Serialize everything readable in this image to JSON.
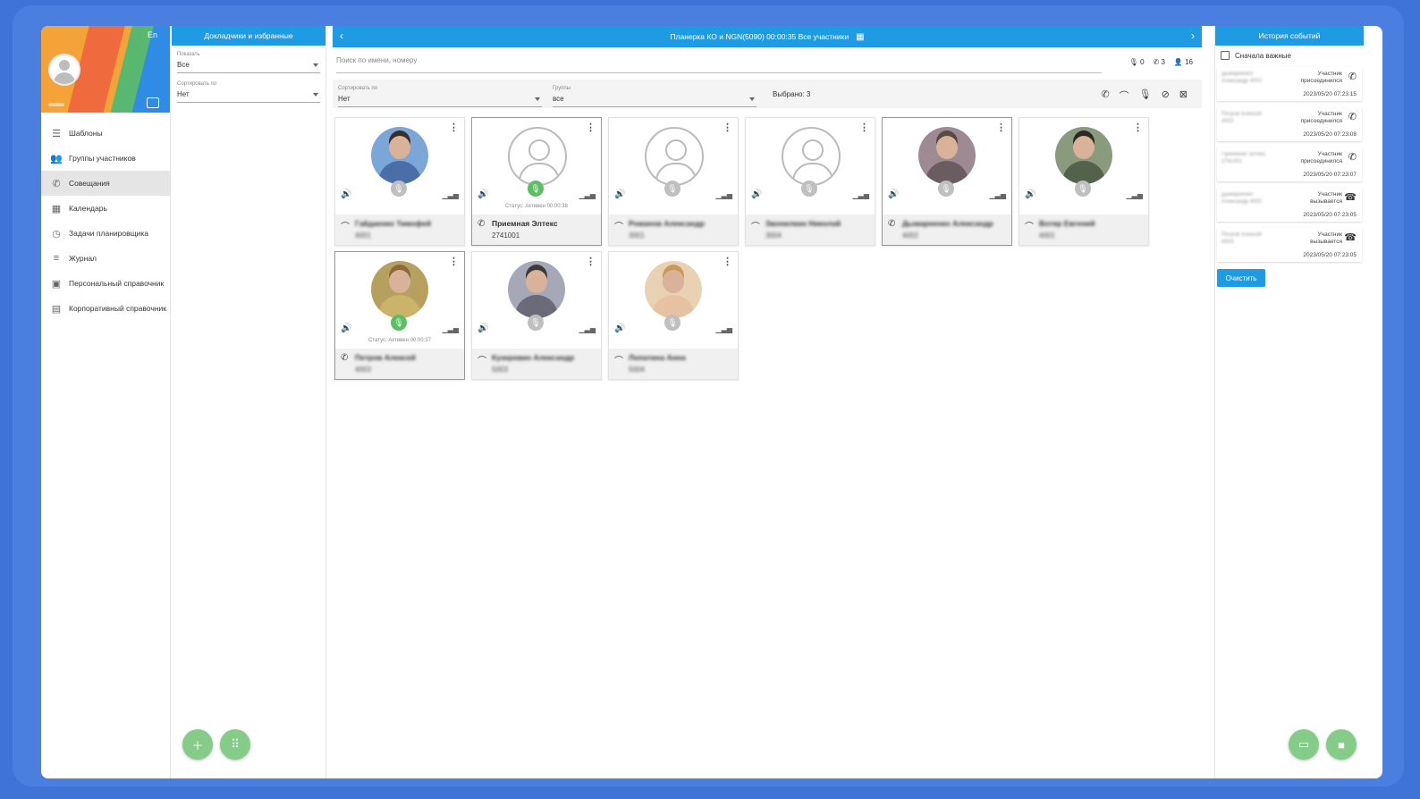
{
  "user": {
    "lang": "En",
    "ext": "4002"
  },
  "nav": [
    {
      "label": "Шаблоны",
      "icon": "☰",
      "name": "templates-icon"
    },
    {
      "label": "Группы участников",
      "icon": "👥",
      "name": "groups-icon"
    },
    {
      "label": "Совещания",
      "icon": "✆",
      "name": "phone-icon"
    },
    {
      "label": "Календарь",
      "icon": "▦",
      "name": "calendar-icon"
    },
    {
      "label": "Задачи планировщика",
      "icon": "◷",
      "name": "clock-icon"
    },
    {
      "label": "Журнал",
      "icon": "≡",
      "name": "journal-icon"
    },
    {
      "label": "Персональный справочник",
      "icon": "▣",
      "name": "personal-book-icon"
    },
    {
      "label": "Корпоративный справочник",
      "icon": "▤",
      "name": "corporate-book-icon"
    }
  ],
  "speakers": {
    "title": "Докладчики и избранные",
    "show_label": "Показать",
    "show_value": "Все",
    "sort_label": "Сортировать по",
    "sort_value": "Нет"
  },
  "conference": {
    "title": "Планерка КО и NGN(5090)  00:00:35  Все участники",
    "search_placeholder": "Поиск по имени, номеру",
    "counters": {
      "muted": "0",
      "calls": "3",
      "participants": "16"
    },
    "sort_label": "Сортировать по",
    "sort_value": "Нет",
    "group_label": "Группы",
    "group_value": "все",
    "selected": "Выбрано: 3"
  },
  "participants": [
    {
      "name": "Гайдаенко Тимофей",
      "number": "4001",
      "blur": true,
      "status": "",
      "mic": "off",
      "photo": "fill",
      "hair": "#3a2e26",
      "shirt": "#4a6fa8",
      "bg": "#7aa6d8",
      "selected": false,
      "icon": "⌒"
    },
    {
      "name": "Приемная Элтекс",
      "number": "2741001",
      "blur": false,
      "status": "Статус: Активен 00:00:38",
      "mic": "on",
      "photo": "def",
      "selected": true,
      "icon": "✆"
    },
    {
      "name": "Романов Александр",
      "number": "3001",
      "blur": true,
      "status": "",
      "mic": "off",
      "photo": "def",
      "selected": false,
      "icon": "⌒"
    },
    {
      "name": "Звонилкин Николай",
      "number": "3004",
      "blur": true,
      "status": "",
      "mic": "off",
      "photo": "def",
      "selected": false,
      "icon": "⌒"
    },
    {
      "name": "Дымарненко Александр",
      "number": "4002",
      "blur": true,
      "status": "",
      "mic": "off",
      "photo": "fill",
      "hair": "#5a4a44",
      "shirt": "#6b5c62",
      "bg": "#9d8a92",
      "selected": true,
      "icon": "✆"
    },
    {
      "name": "Вотяр Евгений",
      "number": "4001",
      "blur": true,
      "status": "",
      "mic": "off",
      "photo": "fill",
      "hair": "#2c2a20",
      "shirt": "#53624a",
      "bg": "#8a9a7c",
      "selected": false,
      "icon": "⌒"
    },
    {
      "name": "Петров Алексей",
      "number": "4003",
      "blur": true,
      "status": "Статус: Активен 00:00:37",
      "mic": "on",
      "photo": "fill",
      "hair": "#8a6a3c",
      "shirt": "#c9b46a",
      "bg": "#b7a05e",
      "selected": true,
      "icon": "✆"
    },
    {
      "name": "Кузеревин Александр",
      "number": "5003",
      "blur": true,
      "status": "",
      "mic": "off",
      "photo": "fill",
      "hair": "#3e3a3a",
      "shirt": "#6a6a78",
      "bg": "#a6a8b8",
      "selected": false,
      "icon": "⌒"
    },
    {
      "name": "Лопатина Анна",
      "number": "5004",
      "blur": true,
      "status": "",
      "mic": "off",
      "photo": "fill",
      "hair": "#c89a5a",
      "shirt": "#e6c2a2",
      "bg": "#e9d2b4",
      "selected": false,
      "icon": "⌒"
    }
  ],
  "history": {
    "title": "История событий",
    "important_label": "Сначала важные",
    "clear_label": "Очистить",
    "events": [
      {
        "who": "Дымарненко Александр 4002",
        "what": "Участник присоединился",
        "time": "2023/05/20 07:23:15",
        "icon": "✆"
      },
      {
        "who": "Петров Алексей 4003",
        "what": "Участник присоединился",
        "time": "2023/05/20 07:23:08",
        "icon": "✆"
      },
      {
        "who": "Приемная Элтекс 2741001",
        "what": "Участник присоединился",
        "time": "2023/05/20 07:23:07",
        "icon": "✆"
      },
      {
        "who": "Дымарненко Александр 4002",
        "what": "Участник вызывается",
        "time": "2023/05/20 07:23:05",
        "icon": "☎"
      },
      {
        "who": "Петров Алексей 4003",
        "what": "Участник вызывается",
        "time": "2023/05/20 07:23:05",
        "icon": "☎"
      }
    ]
  },
  "colors": {
    "accent": "#1f9be3",
    "fab": "#84cc88",
    "mic_on": "#5cbf62"
  }
}
